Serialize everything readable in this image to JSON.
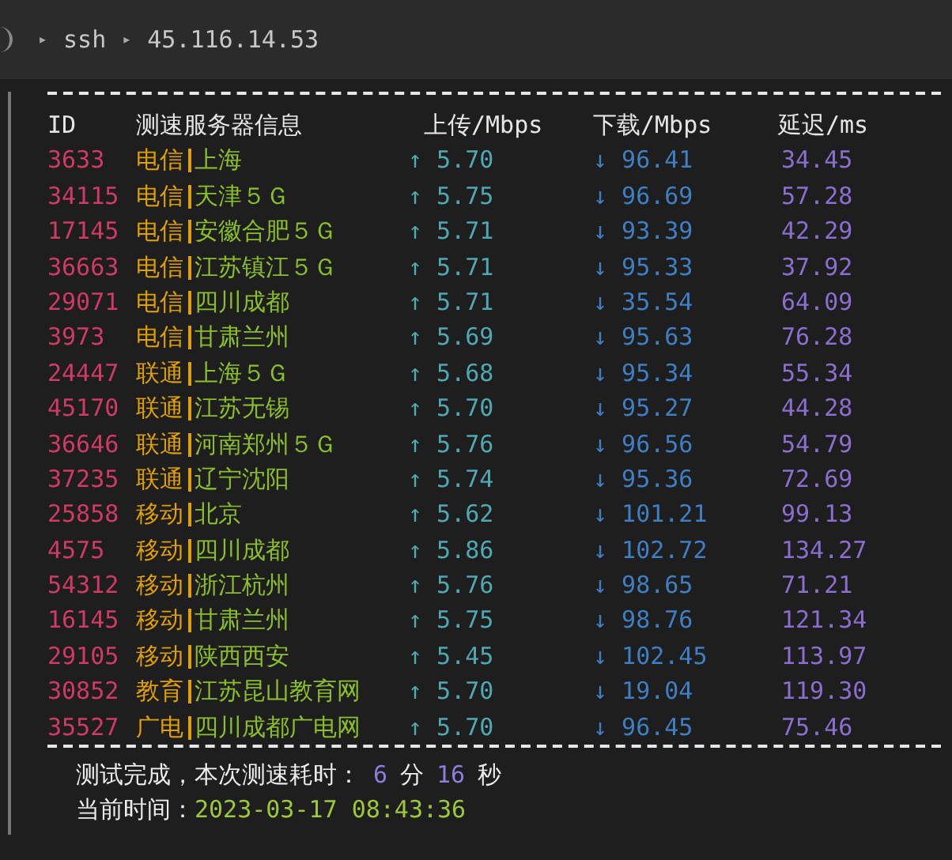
{
  "tab_bar": {
    "path": [
      {
        "glyph": "▸",
        "label": "ssh"
      },
      {
        "glyph": "▸",
        "label": "45.116.14.53"
      }
    ]
  },
  "table": {
    "columns": [
      "ID",
      "测速服务器信息",
      "上传/Mbps",
      "下载/Mbps",
      "延迟/ms"
    ],
    "rows": [
      {
        "id": "3633",
        "isp": "电信",
        "location": "上海",
        "upload": "↑ 5.70",
        "download": "↓ 96.41",
        "latency": "34.45"
      },
      {
        "id": "34115",
        "isp": "电信",
        "location": "天津５Ｇ",
        "upload": "↑ 5.75",
        "download": "↓ 96.69",
        "latency": "57.28"
      },
      {
        "id": "17145",
        "isp": "电信",
        "location": "安徽合肥５Ｇ",
        "upload": "↑ 5.71",
        "download": "↓ 93.39",
        "latency": "42.29"
      },
      {
        "id": "36663",
        "isp": "电信",
        "location": "江苏镇江５Ｇ",
        "upload": "↑ 5.71",
        "download": "↓ 95.33",
        "latency": "37.92"
      },
      {
        "id": "29071",
        "isp": "电信",
        "location": "四川成都",
        "upload": "↑ 5.71",
        "download": "↓ 35.54",
        "latency": "64.09"
      },
      {
        "id": "3973",
        "isp": "电信",
        "location": "甘肃兰州",
        "upload": "↑ 5.69",
        "download": "↓ 95.63",
        "latency": "76.28"
      },
      {
        "id": "24447",
        "isp": "联通",
        "location": "上海５Ｇ",
        "upload": "↑ 5.68",
        "download": "↓ 95.34",
        "latency": "55.34"
      },
      {
        "id": "45170",
        "isp": "联通",
        "location": "江苏无锡",
        "upload": "↑ 5.70",
        "download": "↓ 95.27",
        "latency": "44.28"
      },
      {
        "id": "36646",
        "isp": "联通",
        "location": "河南郑州５Ｇ",
        "upload": "↑ 5.76",
        "download": "↓ 96.56",
        "latency": "54.79"
      },
      {
        "id": "37235",
        "isp": "联通",
        "location": "辽宁沈阳",
        "upload": "↑ 5.74",
        "download": "↓ 95.36",
        "latency": "72.69"
      },
      {
        "id": "25858",
        "isp": "移动",
        "location": "北京",
        "upload": "↑ 5.62",
        "download": "↓ 101.21",
        "latency": "99.13"
      },
      {
        "id": "4575",
        "isp": "移动",
        "location": "四川成都",
        "upload": "↑ 5.86",
        "download": "↓ 102.72",
        "latency": "134.27"
      },
      {
        "id": "54312",
        "isp": "移动",
        "location": "浙江杭州",
        "upload": "↑ 5.76",
        "download": "↓ 98.65",
        "latency": "71.21"
      },
      {
        "id": "16145",
        "isp": "移动",
        "location": "甘肃兰州",
        "upload": "↑ 5.75",
        "download": "↓ 98.76",
        "latency": "121.34"
      },
      {
        "id": "29105",
        "isp": "移动",
        "location": "陕西西安",
        "upload": "↑ 5.45",
        "download": "↓ 102.45",
        "latency": "113.97"
      },
      {
        "id": "30852",
        "isp": "教育",
        "location": "江苏昆山教育网",
        "upload": "↑ 5.70",
        "download": "↓ 19.04",
        "latency": "119.30"
      },
      {
        "id": "35527",
        "isp": "广电",
        "location": "四川成都广电网",
        "upload": "↑ 5.70",
        "download": "↓ 96.45",
        "latency": "75.46"
      }
    ]
  },
  "summary": {
    "label": "测试完成，本次测速耗时：",
    "minutes": "6",
    "minutes_unit": "分",
    "seconds": "16",
    "seconds_unit": "秒"
  },
  "time": {
    "label": "当前时间：",
    "value": "2023-03-17 08:43:36"
  }
}
